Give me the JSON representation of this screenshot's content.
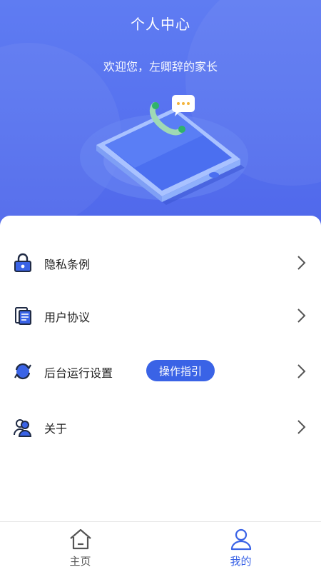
{
  "header": {
    "title": "个人中心",
    "welcome": "欢迎您，左卿辞的家长"
  },
  "menu": {
    "items": [
      {
        "label": "隐私条例",
        "icon": "lock-icon"
      },
      {
        "label": "用户协议",
        "icon": "document-icon"
      },
      {
        "label": "后台运行设置",
        "icon": "sync-icon",
        "badge": "操作指引"
      },
      {
        "label": "关于",
        "icon": "users-icon"
      }
    ]
  },
  "tabbar": {
    "tabs": [
      {
        "label": "主页",
        "icon": "home-icon",
        "active": false
      },
      {
        "label": "我的",
        "icon": "user-icon",
        "active": true
      }
    ]
  },
  "colors": {
    "accent": "#3a63e6",
    "header_bg": "#5671ef",
    "active_tab": "#3a63e6",
    "inactive_tab": "#555555"
  }
}
